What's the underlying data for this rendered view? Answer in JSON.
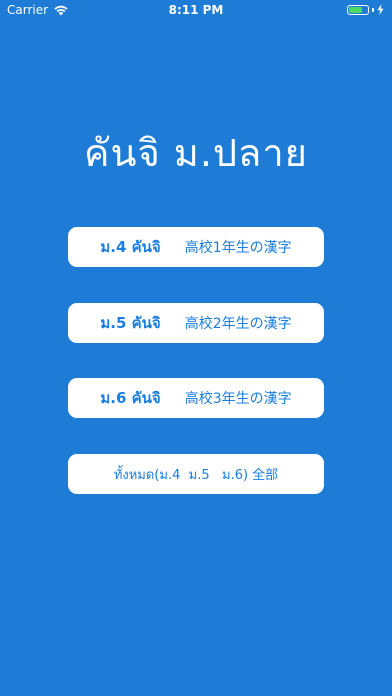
{
  "status_bar": {
    "carrier": "Carrier",
    "time": "8:11 PM",
    "wifi_icon": "wifi-icon",
    "battery_icon": "battery-icon",
    "battery_level": 0.7,
    "battery_color": "#4cd964"
  },
  "screen": {
    "title": "คันจิ ม.ปลาย",
    "background_color": "#1e7bd6",
    "button_text_color": "#1a7ee0"
  },
  "menu": {
    "m4": {
      "thai": "ม.4 คันจิ",
      "japanese": "高校1年生の漢字"
    },
    "m5": {
      "thai": "ม.5 คันจิ",
      "japanese": "高校2年生の漢字"
    },
    "m6": {
      "thai": "ม.6 คันจิ",
      "japanese": "高校3年生の漢字"
    },
    "all": {
      "label": "ทั้งหมด(ม.4  ม.5   ม.6) 全部"
    }
  }
}
